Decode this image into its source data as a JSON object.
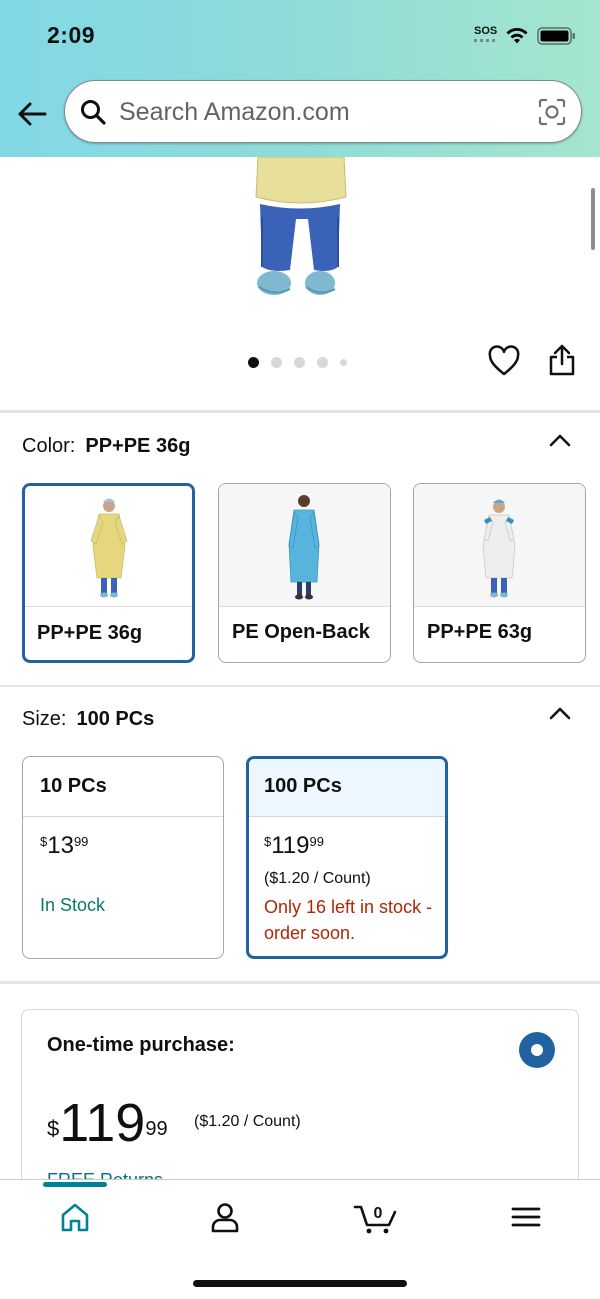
{
  "status_bar": {
    "time": "2:09",
    "sos": "SOS"
  },
  "search": {
    "placeholder": "Search Amazon.com"
  },
  "gallery": {
    "image_count": 5,
    "active_index": 0
  },
  "color": {
    "label": "Color:",
    "selected": "PP+PE 36g",
    "options": [
      {
        "label": "PP+PE 36g",
        "gown_color": "#e6d77e"
      },
      {
        "label": "PE Open-Back",
        "gown_color": "#57b4dc"
      },
      {
        "label": "PP+PE 63g",
        "gown_color": "#eeeeee"
      }
    ]
  },
  "size": {
    "label": "Size:",
    "selected": "100 PCs",
    "options": [
      {
        "label": "10 PCs",
        "price_dollar": "$",
        "price_whole": "13",
        "price_cents": "99",
        "stock": "In Stock"
      },
      {
        "label": "100 PCs",
        "price_dollar": "$",
        "price_whole": "119",
        "price_cents": "99",
        "unit": "($1.20 / Count)",
        "stock": "Only 16 left in stock - order soon."
      }
    ]
  },
  "purchase": {
    "title": "One-time purchase:",
    "currency": "$",
    "price_whole": "119",
    "price_cents": "99",
    "unit": "($1.20 / Count)",
    "free_returns": "FREE Returns"
  },
  "bottom_nav": {
    "items": [
      "home-icon",
      "account-icon",
      "cart-icon",
      "menu-icon"
    ],
    "cart_count": "0",
    "active_color": "#008296"
  },
  "colors": {
    "accent": "#2162a1",
    "in_stock": "#067d62",
    "low_stock": "#b12704",
    "link": "#007185"
  }
}
